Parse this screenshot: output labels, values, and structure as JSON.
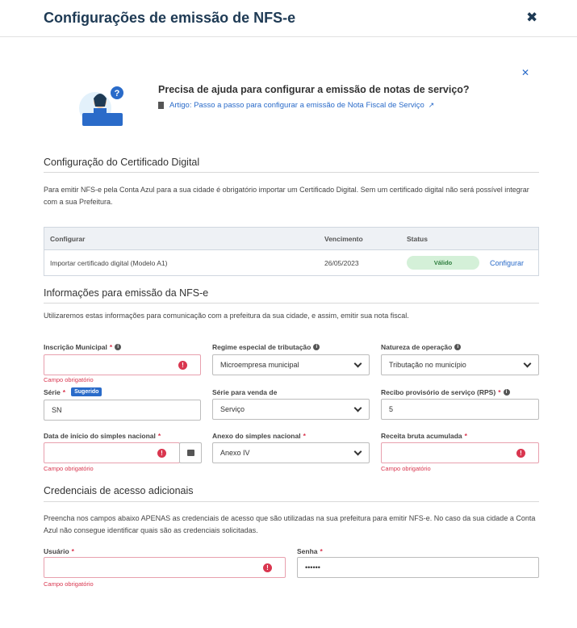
{
  "header": {
    "title": "Configurações de emissão de NFS-e",
    "close_glyph": "✖"
  },
  "help": {
    "title": "Precisa de ajuda para configurar a emissão de notas de serviço?",
    "link": "Artigo: Passo a passo para configurar a emissão de Nota Fiscal de Serviço",
    "close_glyph": "✕",
    "illustration_glyph": "?"
  },
  "cert": {
    "section_title": "Configuração do Certificado Digital",
    "description": "Para emitir NFS-e pela Conta Azul para a sua cidade é obrigatório importar um Certificado Digital. Sem um certificado digital não será possível integrar com a sua Prefeitura.",
    "columns": [
      "Configurar",
      "Vencimento",
      "Status"
    ],
    "row": {
      "name": "Importar certificado digital (Modelo A1)",
      "expiry": "26/05/2023",
      "status": "Válido",
      "action": "Configurar"
    }
  },
  "info": {
    "section_title": "Informações para emissão da NFS-e",
    "description": "Utilizaremos estas informações para comunicação com a prefeitura da sua cidade, e assim, emitir sua nota fiscal."
  },
  "fields": {
    "inscricao": {
      "label": "Inscrição Municipal",
      "required": "*",
      "value": "",
      "error": "Campo obrigatório"
    },
    "regime": {
      "label": "Regime especial de tributação",
      "value": "Microempresa municipal"
    },
    "natureza": {
      "label": "Natureza de operação",
      "value": "Tributação no município"
    },
    "serie": {
      "label": "Série",
      "required": "*",
      "badge": "Sugerido",
      "value": "SN"
    },
    "serie_venda": {
      "label": "Série para venda de",
      "value": "Serviço"
    },
    "rps": {
      "label": "Recibo provisório de serviço (RPS)",
      "required": "*",
      "value": "5"
    },
    "data_inicio": {
      "label": "Data de início do simples nacional",
      "required": "*",
      "value": "",
      "error": "Campo obrigatório"
    },
    "anexo": {
      "label": "Anexo do simples nacional",
      "required": "*",
      "value": "Anexo IV"
    },
    "receita": {
      "label": "Receita bruta acumulada",
      "required": "*",
      "value": "",
      "error": "Campo obrigatório"
    }
  },
  "creds": {
    "section_title": "Credenciais de acesso adicionais",
    "description": "Preencha nos campos abaixo APENAS as credenciais de acesso que são utilizadas na sua prefeitura para emitir NFS-e. No caso da sua cidade a Conta Azul não consegue identificar quais são as credenciais solicitadas.",
    "usuario": {
      "label": "Usuário",
      "required": "*",
      "value": "",
      "error": "Campo obrigatório"
    },
    "senha": {
      "label": "Senha",
      "required": "*",
      "value": "••••••"
    }
  },
  "icons": {
    "info": "i",
    "error": "!",
    "close": "close-icon",
    "external": "↗"
  },
  "colors": {
    "title": "#1e3a54",
    "link": "#2a6bc9",
    "error": "#d9364f",
    "valid_bg": "#d4f0d8",
    "valid_text": "#2e7d3e"
  }
}
